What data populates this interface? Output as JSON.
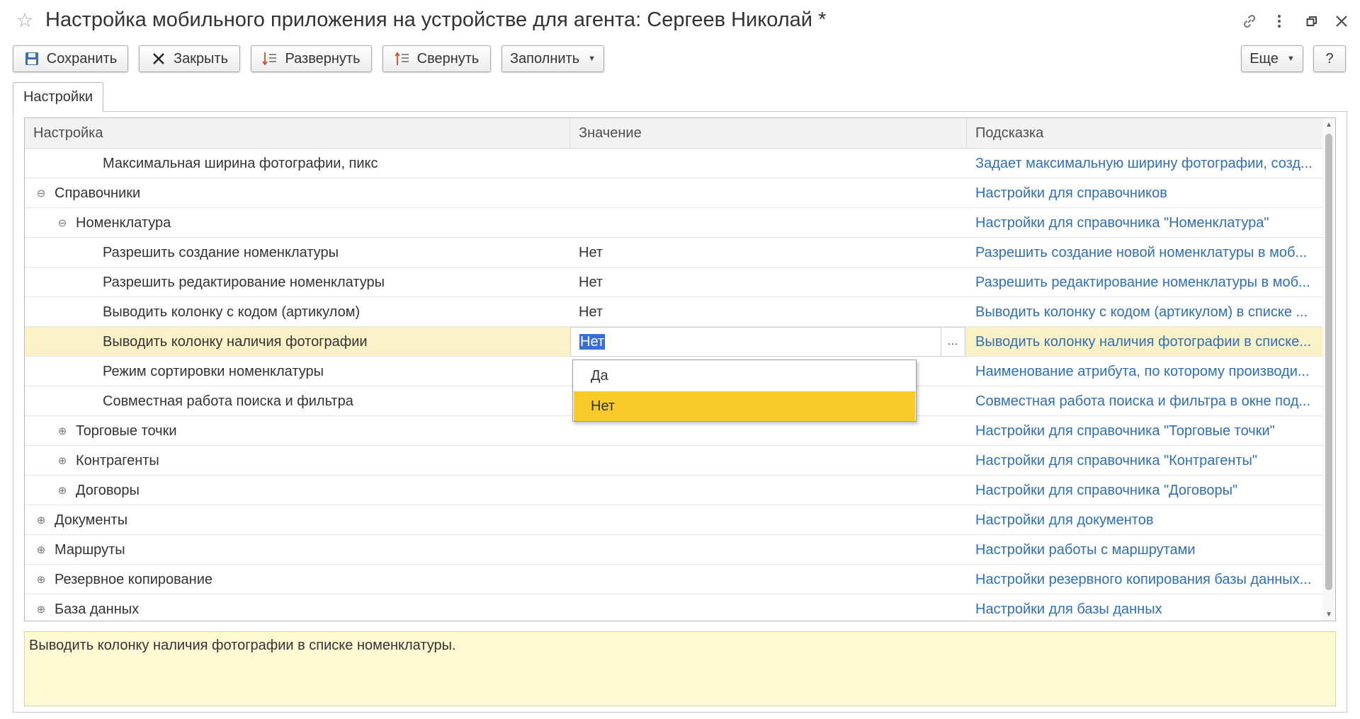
{
  "window": {
    "title": "Настройка мобильного приложения на устройстве для агента: Сергеев Николай *",
    "icons": [
      "star-icon",
      "link-icon",
      "more-vertical-icon",
      "restore-icon",
      "close-icon"
    ]
  },
  "toolbar": {
    "save_label": "Сохранить",
    "close_label": "Закрыть",
    "expand_label": "Развернуть",
    "collapse_label": "Свернуть",
    "fill_label": "Заполнить",
    "more_label": "Еще",
    "help_label": "?"
  },
  "tabs": [
    {
      "label": "Настройки",
      "active": true
    }
  ],
  "grid": {
    "columns": [
      "Настройка",
      "Значение",
      "Подсказка"
    ],
    "rows": [
      {
        "name": "Максимальная ширина фотографии, пикс",
        "value": "",
        "hint": "Задает максимальную ширину фотографии, созд...",
        "level": 2,
        "toggle": ""
      },
      {
        "name": "Справочники",
        "value": "",
        "hint": "Настройки для справочников",
        "level": 0,
        "toggle": "collapse"
      },
      {
        "name": "Номенклатура",
        "value": "",
        "hint": "Настройки для справочника \"Номенклатура\"",
        "level": 1,
        "toggle": "collapse"
      },
      {
        "name": "Разрешить создание номенклатуры",
        "value": "Нет",
        "hint": "Разрешить создание новой номенклатуры в моб...",
        "level": 2,
        "toggle": ""
      },
      {
        "name": "Разрешить редактирование номенклатуры",
        "value": "Нет",
        "hint": "Разрешить редактирование номенклатуры в моб...",
        "level": 2,
        "toggle": ""
      },
      {
        "name": "Выводить колонку с кодом (артикулом)",
        "value": "Нет",
        "hint": "Выводить колонку с кодом (артикулом) в списке ...",
        "level": 2,
        "toggle": ""
      },
      {
        "name": "Выводить колонку наличия фотографии",
        "value": "Нет",
        "hint": "Выводить колонку наличия фотографии в списке...",
        "level": 2,
        "toggle": "",
        "selected": true,
        "editing": true
      },
      {
        "name": "Режим сортировки номенклатуры",
        "value": "",
        "hint": "Наименование атрибута, по которому производи...",
        "level": 2,
        "toggle": ""
      },
      {
        "name": "Совместная работа поиска и фильтра",
        "value": "",
        "hint": "Совместная работа поиска и фильтра в окне под...",
        "level": 2,
        "toggle": ""
      },
      {
        "name": "Торговые точки",
        "value": "",
        "hint": "Настройки для справочника \"Торговые точки\"",
        "level": 1,
        "toggle": "expand"
      },
      {
        "name": "Контрагенты",
        "value": "",
        "hint": "Настройки для справочника \"Контрагенты\"",
        "level": 1,
        "toggle": "expand"
      },
      {
        "name": "Договоры",
        "value": "",
        "hint": "Настройки для справочника \"Договоры\"",
        "level": 1,
        "toggle": "expand"
      },
      {
        "name": "Документы",
        "value": "",
        "hint": "Настройки для документов",
        "level": 0,
        "toggle": "expand"
      },
      {
        "name": "Маршруты",
        "value": "",
        "hint": "Настройки работы с маршрутами",
        "level": 0,
        "toggle": "expand"
      },
      {
        "name": "Резервное копирование",
        "value": "",
        "hint": "Настройки резервного копирования базы данных...",
        "level": 0,
        "toggle": "expand"
      },
      {
        "name": "База данных",
        "value": "",
        "hint": "Настройки для базы данных",
        "level": 0,
        "toggle": "expand"
      }
    ]
  },
  "dropdown": {
    "options": [
      "Да",
      "Нет"
    ],
    "selected": "Нет"
  },
  "hint_text": "Выводить колонку наличия фотографии в списке номенклатуры.",
  "colors": {
    "hint_link": "#2f6fb5",
    "selected_row": "#fbf1c7",
    "dropdown_active": "#f8cb2a",
    "hint_area_bg": "#fdf9d2",
    "edit_selection": "#3a6dd6"
  }
}
